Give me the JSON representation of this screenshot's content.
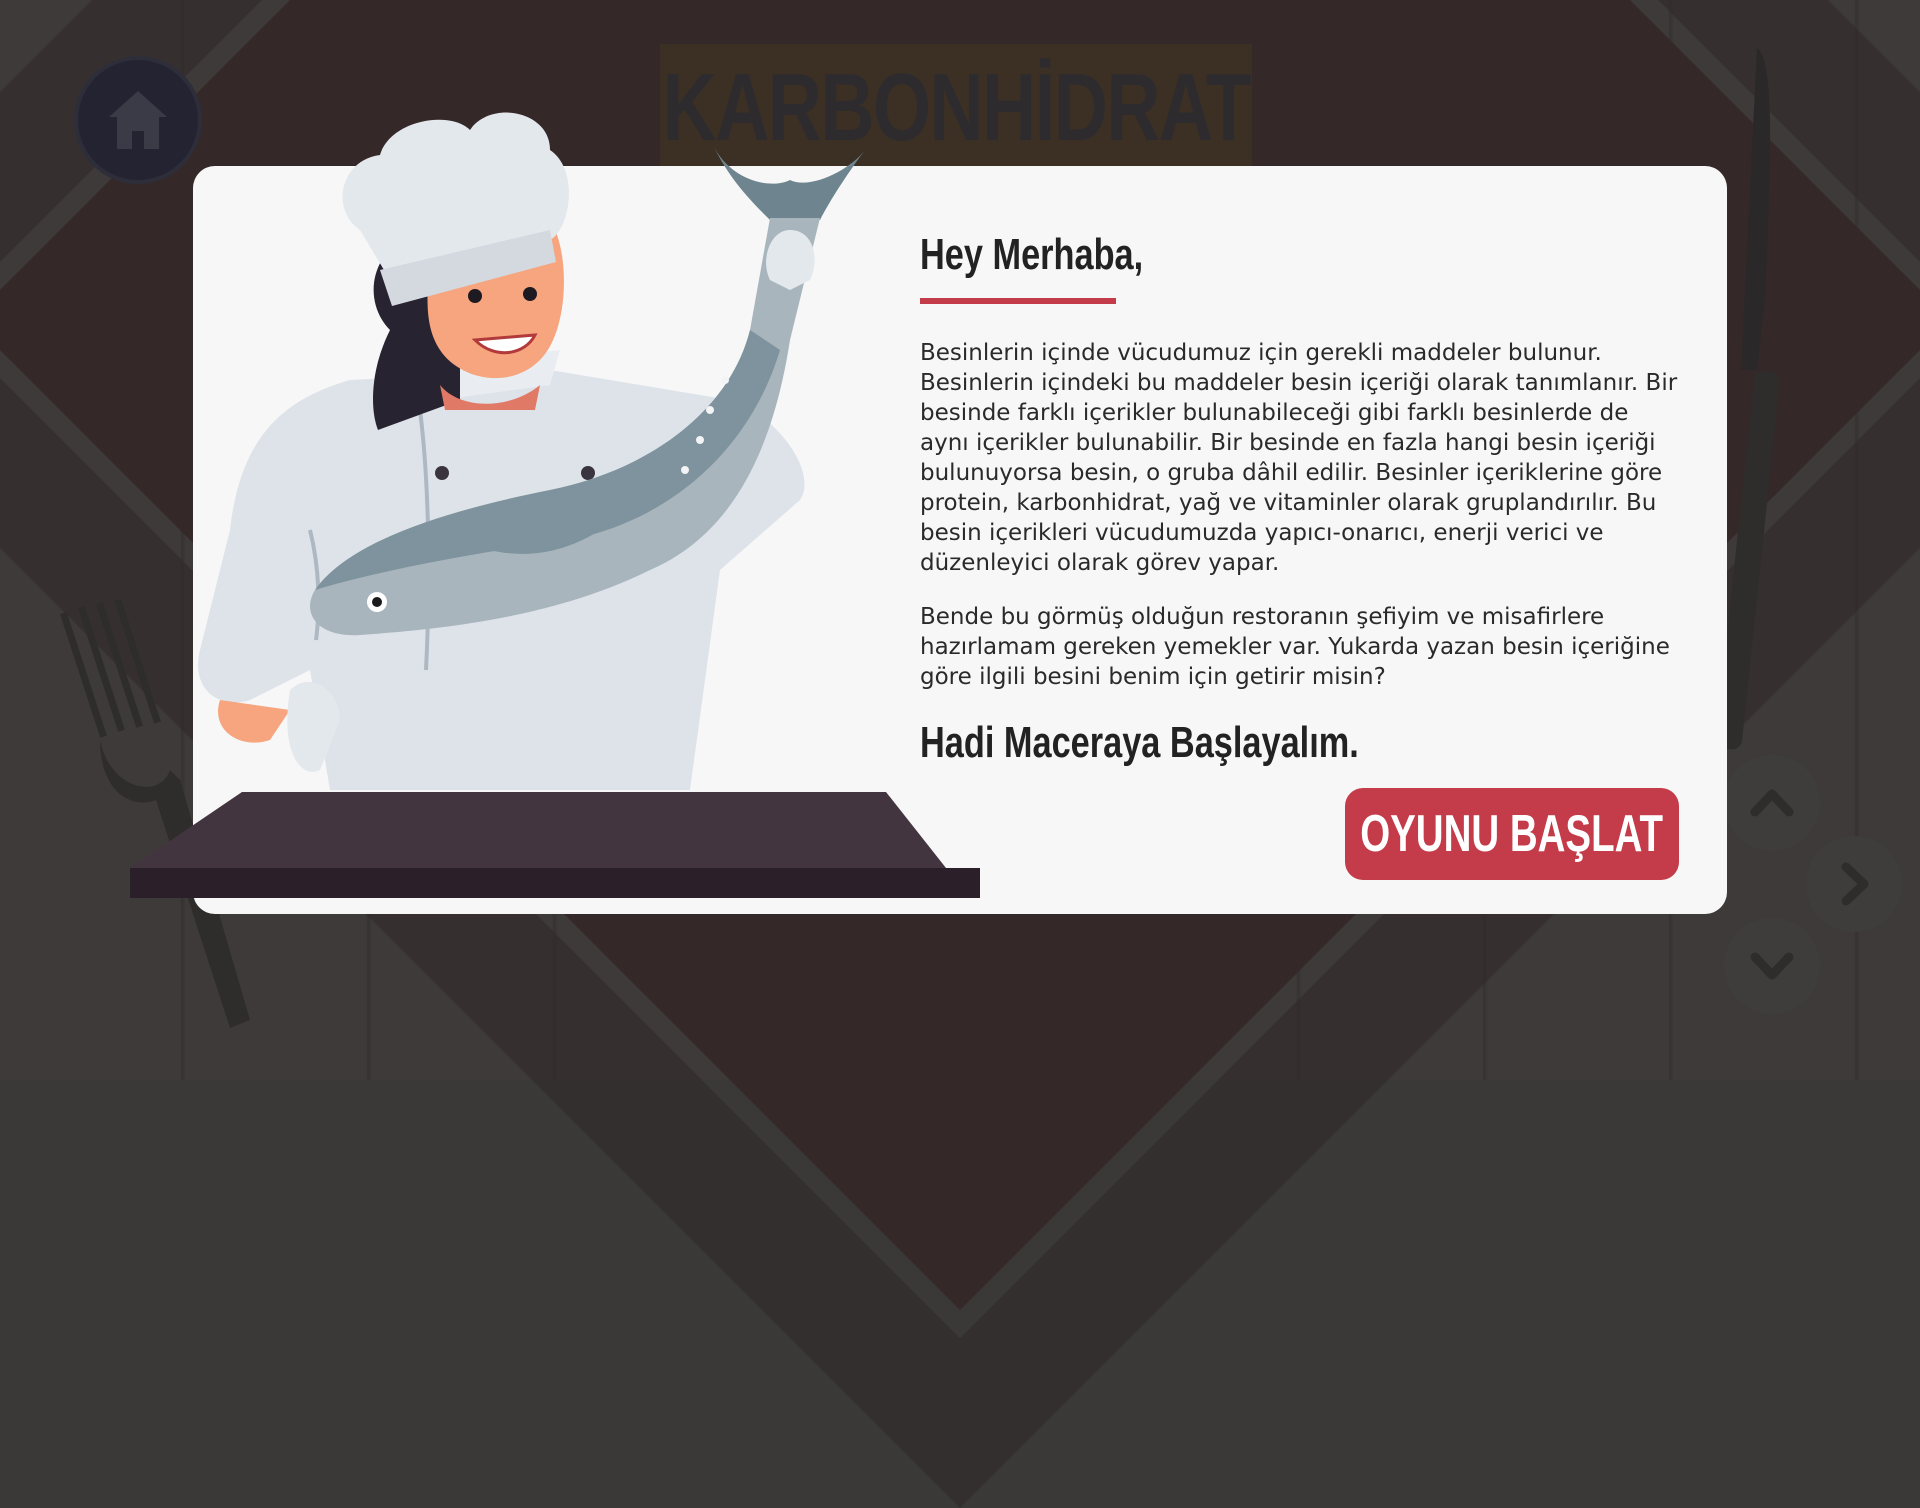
{
  "title": "KARBONHİDRAT",
  "dialog": {
    "greeting": "Hey Merhaba,",
    "paragraph1": "Besinlerin içinde vücudumuz için gerekli maddeler bulunur. Besinlerin içindeki bu maddeler besin içeriği olarak tanımlanır. Bir besinde farklı içerikler bulunabileceği gibi farklı besinlerde de aynı içerikler bulunabilir. Bir besinde en fazla hangi besin içeriği bulunuyorsa besin, o gruba dâhil edilir. Besinler içeriklerine göre protein, karbonhidrat, yağ ve vitaminler olarak gruplandırılır. Bu besin içerikleri vücudumuzda yapıcı-onarıcı, enerji verici ve düzenleyici olarak görev yapar.",
    "paragraph2": "Bende bu görmüş olduğun restoranın şefiyim ve misafirlere hazırlamam gereken yemekler var. Yukarda yazan besin içeriğine göre ilgili besini benim için getirir misin?",
    "cta_heading": "Hadi Maceraya Başlayalım.",
    "start_button": "OYUNU BAŞLAT"
  },
  "icons": {
    "home": "home-icon",
    "up": "chevron-up-icon",
    "right": "chevron-right-icon",
    "down": "chevron-down-icon"
  },
  "colors": {
    "accent": "#c43c49",
    "dialog_bg": "#f7f7f7",
    "background": "#3b3838"
  }
}
